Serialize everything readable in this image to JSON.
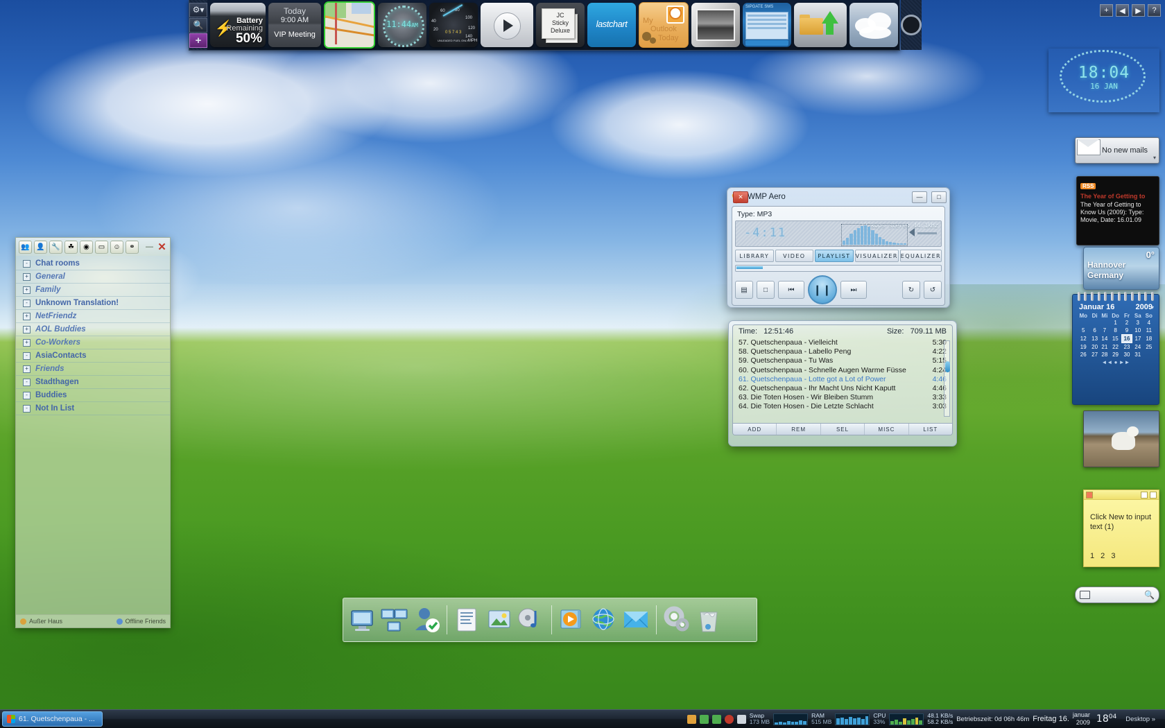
{
  "desktop": {
    "wallpaper_name": "bliss-green-hills"
  },
  "top_dock": {
    "side_buttons": [
      {
        "name": "settings",
        "glyph": "⚙▾"
      },
      {
        "name": "search",
        "glyph": "🔍"
      },
      {
        "name": "add",
        "glyph": "+"
      }
    ],
    "tiles": [
      {
        "id": "battery",
        "line1": "Battery",
        "line2": "Remaining",
        "line3": "50%"
      },
      {
        "id": "today",
        "line1": "Today",
        "line2": "9:00 AM",
        "line3": "VIP Meeting"
      },
      {
        "id": "map",
        "label": "map-gadget"
      },
      {
        "id": "clock",
        "time": "11:44",
        "ampm": "AM"
      },
      {
        "id": "speedometer",
        "marks": [
          "20",
          "40",
          "60",
          "80",
          "100",
          "120",
          "140"
        ],
        "unit": "MPH",
        "fuel": "UNLEADED FUEL ONLY",
        "odo": "0 5 7 4 3"
      },
      {
        "id": "media-play",
        "label": "play-button"
      },
      {
        "id": "jc-sticky",
        "line1": "JC",
        "line2": "Sticky",
        "line3": "Deluxe"
      },
      {
        "id": "lastchart",
        "label": "lastchart"
      },
      {
        "id": "my-outlook-today",
        "line1": "My",
        "line2": "Outlook",
        "line3": "Today"
      },
      {
        "id": "photo-frame",
        "label": "photo-frame"
      },
      {
        "id": "sipgate-sms",
        "title": "SIPGATE SMS",
        "footer": "www.sipgate.de",
        "fields": [
          "Sipgate ID",
          "Password",
          "Own Number",
          "Call Number",
          "Your Message",
          "Don't forget the keyword"
        ]
      },
      {
        "id": "folder-upload",
        "label": "upload-folder"
      },
      {
        "id": "weather-clouds",
        "label": "weather"
      }
    ],
    "right_icon": "camera-eye"
  },
  "window_buttons": [
    {
      "name": "add",
      "glyph": "+"
    },
    {
      "name": "prev",
      "glyph": "◀"
    },
    {
      "name": "next",
      "glyph": "▶"
    },
    {
      "name": "help",
      "glyph": "?"
    }
  ],
  "gadgets": {
    "clock": {
      "time": "18:04",
      "date": "16 JAN"
    },
    "mail": {
      "text": "No new mails"
    },
    "rss": {
      "badge": "RSS",
      "headline": "The Year of Getting to",
      "body": "The Year of Getting to Know Us (2009): Type: Movie, Date: 16.01.09"
    },
    "weather": {
      "temp": "0°",
      "city": "Hannover",
      "country": "Germany"
    },
    "calendar": {
      "month": "Januar 16",
      "year": "2009",
      "weekdays": [
        "Mo",
        "Di",
        "Mi",
        "Do",
        "Fr",
        "Sa",
        "So"
      ],
      "weeks": [
        [
          "",
          "",
          "",
          "",
          "1",
          "2",
          "3",
          "4"
        ],
        [
          "5",
          "6",
          "7",
          "8",
          "9",
          "10",
          "11"
        ],
        [
          "12",
          "13",
          "14",
          "15",
          "16",
          "17",
          "18"
        ],
        [
          "19",
          "20",
          "21",
          "22",
          "23",
          "24",
          "25"
        ],
        [
          "26",
          "27",
          "28",
          "29",
          "30",
          "31",
          ""
        ]
      ],
      "selected_day": "16",
      "nav": "◄◄  ●  ►►"
    },
    "picture": {
      "label": "kitten-photo"
    },
    "sticky_note": {
      "text": "Click New to input text (1)",
      "numbers": "1 2 3"
    },
    "search": {
      "placeholder": ""
    }
  },
  "chat_window": {
    "toolbar_icons": [
      "people-icon",
      "add-contact-icon",
      "tools-icon",
      "plugins-icon",
      "sound-icon",
      "window-icon",
      "status-icon",
      "network-icon"
    ],
    "minimize": "—",
    "close": "✕",
    "groups": [
      {
        "name": "Chat rooms",
        "expander": "-",
        "italic": false
      },
      {
        "name": "General",
        "expander": "+",
        "italic": true
      },
      {
        "name": "Family",
        "expander": "+",
        "italic": true
      },
      {
        "name": "Unknown Translation!",
        "expander": "-",
        "italic": false
      },
      {
        "name": "NetFriendz",
        "expander": "+",
        "italic": true
      },
      {
        "name": "AOL Buddies",
        "expander": "+",
        "italic": true
      },
      {
        "name": "Co-Workers",
        "expander": "+",
        "italic": true
      },
      {
        "name": "AsiaContacts",
        "expander": "-",
        "italic": false
      },
      {
        "name": "Friends",
        "expander": "+",
        "italic": true
      },
      {
        "name": "Stadthagen",
        "expander": "-",
        "italic": false
      },
      {
        "name": "Buddies",
        "expander": "-",
        "italic": false
      },
      {
        "name": "Not In List",
        "expander": "-",
        "italic": false
      }
    ],
    "status_left": "Außer Haus",
    "status_right": "Offline Friends"
  },
  "media_player": {
    "title": "WMP Aero",
    "icon": "wmp-icon",
    "buttons": {
      "minimize": "—",
      "maximize": "□",
      "close": "✕"
    },
    "type_label": "Type: MP3",
    "time": "-4:11",
    "bitrate": "192kbps stereo 44.1kHz",
    "tabs": [
      {
        "label": "LIBRARY",
        "active": false
      },
      {
        "label": "VIDEO",
        "active": false
      },
      {
        "label": "PLAYLIST",
        "active": true
      },
      {
        "label": "VISUALIZER",
        "active": false
      },
      {
        "label": "EQUALIZER",
        "active": false
      }
    ],
    "transport": {
      "prev": "⏮",
      "play_pause": "❙❙",
      "next": "⏭",
      "shuffle": "↻",
      "repeat": "↺",
      "open": "▤",
      "stop": "□"
    },
    "eq_bars": [
      8,
      14,
      22,
      30,
      34,
      38,
      40,
      36,
      30,
      22,
      16,
      11,
      7,
      5,
      4,
      3,
      3,
      2
    ]
  },
  "playlist": {
    "time_label": "Time:",
    "time_value": "12:51:46",
    "size_label": "Size:",
    "size_value": "709.11 MB",
    "tracks": [
      {
        "num": "57.",
        "title": "Quetschenpaua - Vielleicht",
        "length": "5:30",
        "current": false
      },
      {
        "num": "58.",
        "title": "Quetschenpaua - Labello Peng",
        "length": "4:22",
        "current": false
      },
      {
        "num": "59.",
        "title": "Quetschenpaua - Tu Was",
        "length": "5:15",
        "current": false
      },
      {
        "num": "60.",
        "title": "Quetschenpaua - Schnelle Augen Warme Füsse",
        "length": "4:24",
        "current": false
      },
      {
        "num": "61.",
        "title": "Quetschenpaua - Lotte got a Lot of Power",
        "length": "4:46",
        "current": true
      },
      {
        "num": "62.",
        "title": "Quetschenpaua - Ihr Macht Uns Nicht Kaputt",
        "length": "4:46",
        "current": false
      },
      {
        "num": "63.",
        "title": "Die Toten Hosen - Wir Bleiben Stumm",
        "length": "3:33",
        "current": false
      },
      {
        "num": "64.",
        "title": "Die Toten Hosen - Die Letzte Schlacht",
        "length": "3:03",
        "current": false
      }
    ],
    "buttons": [
      {
        "label": "ADD"
      },
      {
        "label": "REM"
      },
      {
        "label": "SEL"
      },
      {
        "label": "MISC"
      },
      {
        "label": "LIST"
      }
    ]
  },
  "bottom_dock": {
    "icons": [
      {
        "name": "my-computer"
      },
      {
        "name": "network-places"
      },
      {
        "name": "user-account"
      },
      {
        "name": "documents"
      },
      {
        "name": "pictures"
      },
      {
        "name": "music"
      },
      {
        "name": "media-player"
      },
      {
        "name": "internet-browser"
      },
      {
        "name": "email"
      },
      {
        "name": "control-panel"
      },
      {
        "name": "recycle-bin"
      }
    ]
  },
  "taskbar": {
    "start_label": "",
    "task_title": "61. Quetschenpaua - ...",
    "tray_icons": [
      "security-icon",
      "sync-icon",
      "shield-icon",
      "power-icon",
      "eraser-icon"
    ],
    "meters": [
      {
        "label": "Swap",
        "value": "173 MB"
      },
      {
        "label": "RAM",
        "value": "515 MB"
      },
      {
        "label": "CPU",
        "value": "33%"
      }
    ],
    "network": {
      "down": "48.1 KB/s",
      "up": "58.2 KB/s"
    },
    "uptime": "Betriebszeit: 0d 06h 46m",
    "date_line1": "Freitag 16.",
    "date_line2a": "januar",
    "date_line2b": "2009",
    "clock_big": "18",
    "clock_small": "04",
    "desktop_label": "Desktop",
    "desktop_chevron": "»"
  }
}
